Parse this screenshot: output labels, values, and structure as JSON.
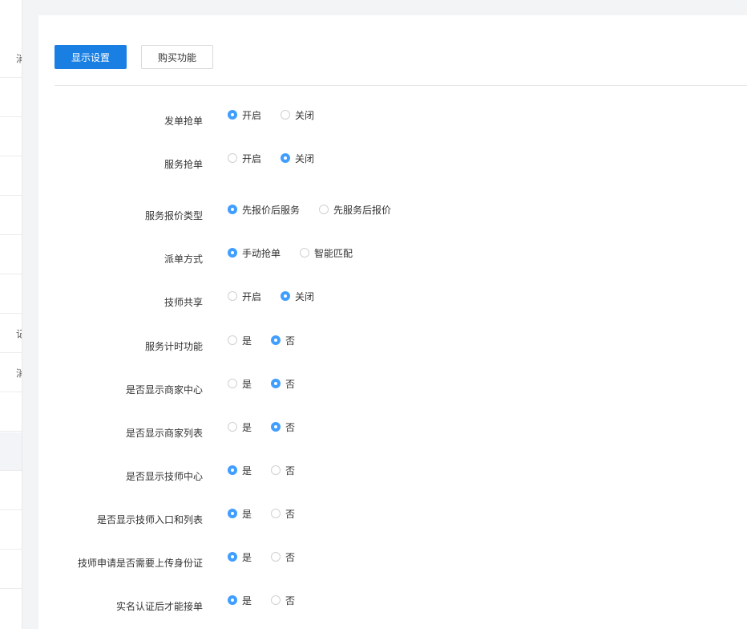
{
  "sidebar": {
    "rows": [
      {
        "char": "",
        "active": false
      },
      {
        "char": "消",
        "active": false
      },
      {
        "char": "",
        "active": false
      },
      {
        "char": "",
        "active": false
      },
      {
        "char": "",
        "active": false
      },
      {
        "char": "",
        "active": false
      },
      {
        "char": "",
        "active": false
      },
      {
        "char": "",
        "active": false
      },
      {
        "char": "记",
        "active": false
      },
      {
        "char": "消",
        "active": false
      },
      {
        "char": "",
        "active": false
      },
      {
        "char": "",
        "active": true
      },
      {
        "char": "",
        "active": false
      },
      {
        "char": "",
        "active": false
      },
      {
        "char": "",
        "active": false
      }
    ]
  },
  "tabs": {
    "display_settings": "显示设置",
    "buy_features": "购买功能"
  },
  "settings": [
    {
      "label": "发单抢单",
      "options": [
        {
          "text": "开启",
          "checked": true
        },
        {
          "text": "关闭",
          "checked": false
        }
      ]
    },
    {
      "label": "服务抢单",
      "options": [
        {
          "text": "开启",
          "checked": false
        },
        {
          "text": "关闭",
          "checked": true
        }
      ]
    },
    {
      "label": "服务报价类型",
      "options": [
        {
          "text": "先报价后服务",
          "checked": true
        },
        {
          "text": "先服务后报价",
          "checked": false
        }
      ]
    },
    {
      "label": "派单方式",
      "options": [
        {
          "text": "手动抢单",
          "checked": true
        },
        {
          "text": "智能匹配",
          "checked": false
        }
      ]
    },
    {
      "label": "技师共享",
      "options": [
        {
          "text": "开启",
          "checked": false
        },
        {
          "text": "关闭",
          "checked": true
        }
      ]
    },
    {
      "label": "服务计时功能",
      "options": [
        {
          "text": "是",
          "checked": false
        },
        {
          "text": "否",
          "checked": true
        }
      ]
    },
    {
      "label": "是否显示商家中心",
      "options": [
        {
          "text": "是",
          "checked": false
        },
        {
          "text": "否",
          "checked": true
        }
      ]
    },
    {
      "label": "是否显示商家列表",
      "options": [
        {
          "text": "是",
          "checked": false
        },
        {
          "text": "否",
          "checked": true
        }
      ]
    },
    {
      "label": "是否显示技师中心",
      "options": [
        {
          "text": "是",
          "checked": true
        },
        {
          "text": "否",
          "checked": false
        }
      ]
    },
    {
      "label": "是否显示技师入口和列表",
      "options": [
        {
          "text": "是",
          "checked": true
        },
        {
          "text": "否",
          "checked": false
        }
      ]
    },
    {
      "label": "技师申请是否需要上传身份证",
      "options": [
        {
          "text": "是",
          "checked": true
        },
        {
          "text": "否",
          "checked": false
        }
      ]
    },
    {
      "label": "实名认证后才能接单",
      "options": [
        {
          "text": "是",
          "checked": true
        },
        {
          "text": "否",
          "checked": false
        }
      ]
    }
  ]
}
